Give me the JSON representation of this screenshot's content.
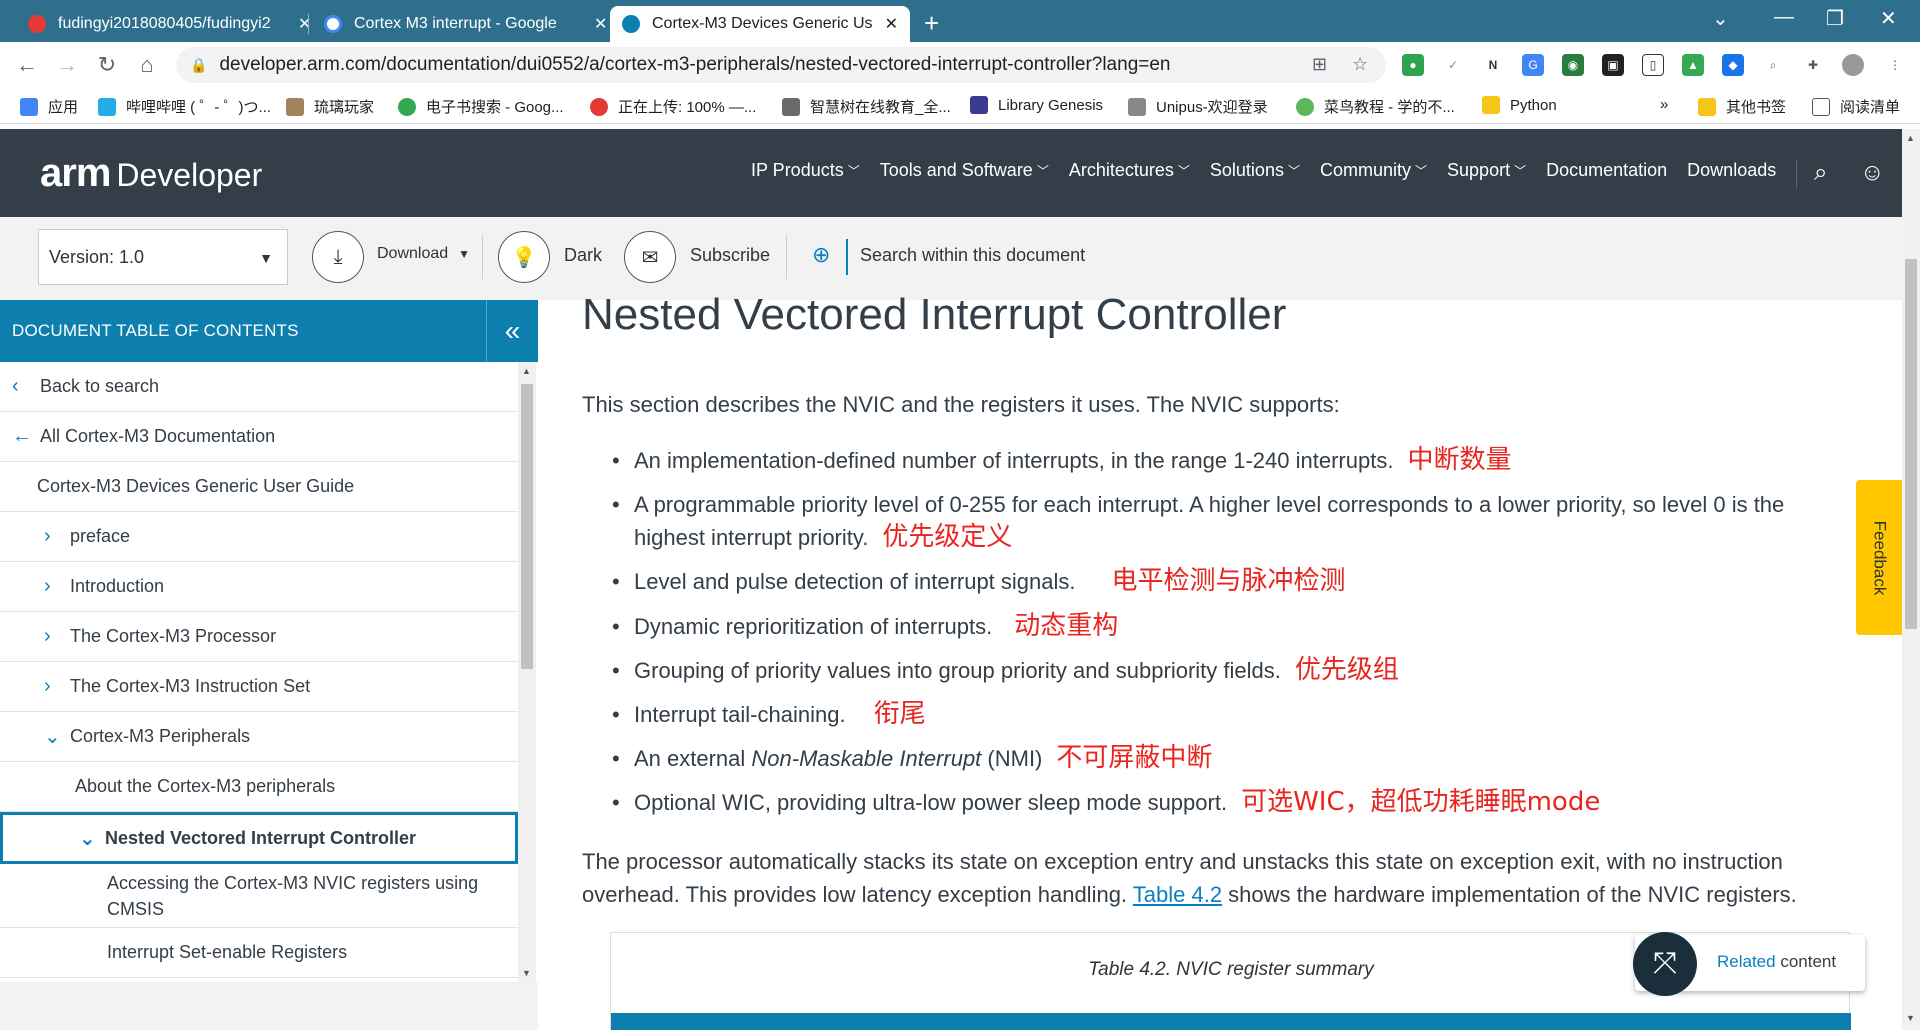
{
  "browser": {
    "tabs": [
      {
        "title": "fudingyi2018080405/fudingyi2",
        "favicon_color": "#e53935"
      },
      {
        "title": "Cortex M3 interrupt - Google",
        "favicon_color": "#ffffff"
      },
      {
        "title": "Cortex-M3 Devices Generic Us",
        "favicon_color": "#0d7fae"
      }
    ],
    "url": "developer.arm.com/documentation/dui0552/a/cortex-m3-peripherals/nested-vectored-interrupt-controller?lang=en",
    "bookmarks": [
      {
        "label": "应用",
        "color": "#4285f4"
      },
      {
        "label": "哔哩哔哩 ( ゜- ゜)つ...",
        "color": "#23ade5"
      },
      {
        "label": "琉璃玩家",
        "color": "#a0845c"
      },
      {
        "label": "电子书搜索 - Goog...",
        "color": "#34a853"
      },
      {
        "label": "正在上传: 100% —...",
        "color": "#e53935"
      },
      {
        "label": "智慧树在线教育_全...",
        "color": "#6a6a6a"
      },
      {
        "label": "Library Genesis",
        "color": "#3b3b8f"
      },
      {
        "label": "Unipus-欢迎登录",
        "color": "#888888"
      },
      {
        "label": "菜鸟教程 - 学的不...",
        "color": "#5cb85c"
      },
      {
        "label": "Python",
        "color": "#f5c518"
      }
    ],
    "bookmarks_overflow": "»",
    "other_bookmarks": "其他书签",
    "reading_list": "阅读清单"
  },
  "header": {
    "logo": "arm",
    "logo_sub": "Developer",
    "nav": [
      {
        "label": "IP Products",
        "dropdown": true
      },
      {
        "label": "Tools and Software",
        "dropdown": true
      },
      {
        "label": "Architectures",
        "dropdown": true
      },
      {
        "label": "Solutions",
        "dropdown": true
      },
      {
        "label": "Community",
        "dropdown": true
      },
      {
        "label": "Support",
        "dropdown": true
      },
      {
        "label": "Documentation",
        "dropdown": false
      },
      {
        "label": "Downloads",
        "dropdown": false
      }
    ]
  },
  "doctools": {
    "version": "Version: 1.0",
    "download": "Download",
    "dark": "Dark",
    "subscribe": "Subscribe",
    "search_placeholder": "Search within this document"
  },
  "toc": {
    "title": "DOCUMENT TABLE OF CONTENTS",
    "items": [
      {
        "label": "Back to search"
      },
      {
        "label": "All Cortex-M3 Documentation"
      },
      {
        "label": "Cortex-M3 Devices Generic User Guide"
      },
      {
        "label": "preface"
      },
      {
        "label": "Introduction"
      },
      {
        "label": "The Cortex-M3 Processor"
      },
      {
        "label": "The Cortex-M3 Instruction Set"
      },
      {
        "label": "Cortex-M3 Peripherals"
      },
      {
        "label": "About the Cortex-M3 peripherals"
      },
      {
        "label": "Nested Vectored Interrupt Controller"
      },
      {
        "label": "Accessing the Cortex-M3 NVIC registers using CMSIS"
      },
      {
        "label": "Interrupt Set-enable Registers"
      }
    ]
  },
  "main": {
    "title": "Nested Vectored Interrupt Controller",
    "intro": "This section describes the NVIC and the registers it uses. The NVIC supports:",
    "features": [
      {
        "text": "An implementation-defined number of interrupts, in the range 1-240 interrupts.",
        "note": "中断数量"
      },
      {
        "text": "A programmable priority level of 0-255 for each interrupt. A higher level corresponds to a lower priority, so level 0 is the highest interrupt priority.",
        "note": "优先级定义"
      },
      {
        "text": "Level and pulse detection of interrupt signals.",
        "note": "电平检测与脉冲检测"
      },
      {
        "text": "Dynamic reprioritization of interrupts.",
        "note": "动态重构"
      },
      {
        "text": "Grouping of priority values into group priority and subpriority fields.",
        "note": "优先级组"
      },
      {
        "text": "Interrupt tail-chaining.",
        "note": "衔尾"
      },
      {
        "text_pre": "An external ",
        "text_em": "Non-Maskable Interrupt",
        "text_post": " (NMI)",
        "note": "不可屏蔽中断"
      },
      {
        "text": "Optional WIC, providing ultra-low power sleep mode support.",
        "note": "可选WIC，超低功耗睡眠mode"
      }
    ],
    "para_pre": "The processor automatically stacks its state on exception entry and unstacks this state on exception exit, with no instruction overhead. This provides low latency exception handling. ",
    "para_link": "Table 4.2",
    "para_post": " shows the hardware implementation of the NVIC registers.",
    "table_caption": "Table 4.2. NVIC register summary"
  },
  "feedback": "Feedback",
  "related": {
    "link": "Related",
    "rest": " content"
  },
  "colors": {
    "arm_header": "#333e48",
    "toc_blue": "#0d7fae",
    "link_blue": "#0a7fbf",
    "annotation_red": "#e8261f",
    "feedback_yellow": "#ffc700"
  }
}
